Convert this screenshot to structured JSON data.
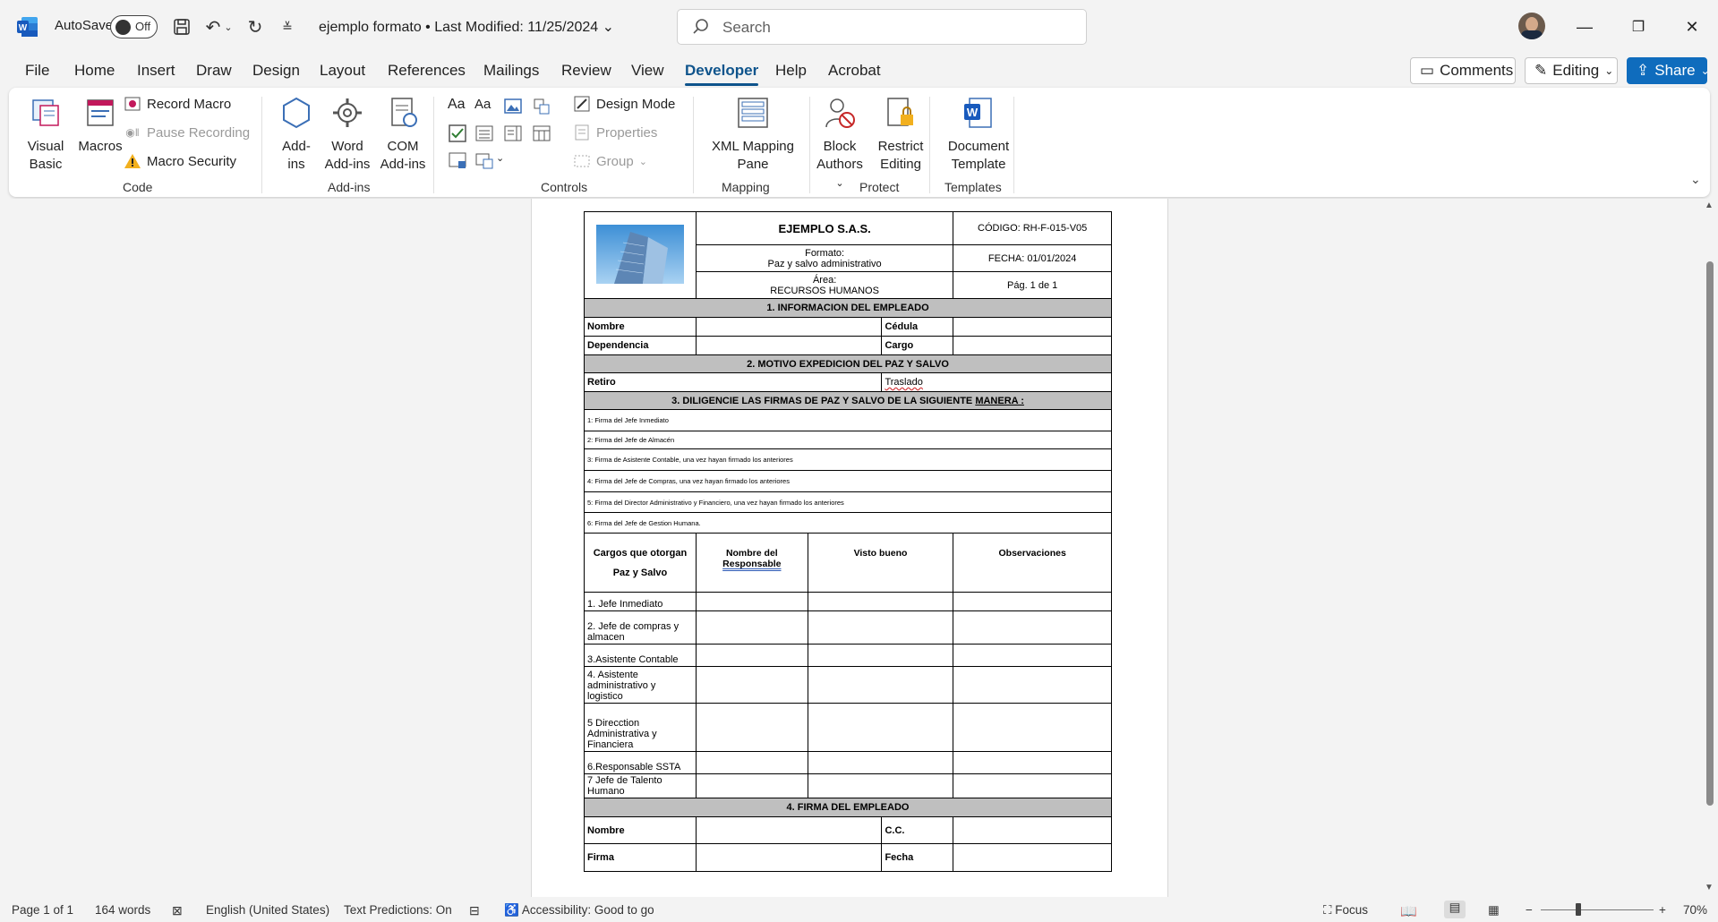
{
  "titlebar": {
    "autosave_label": "AutoSave",
    "autosave_state": "Off",
    "doc_title": "ejemplo formato • Last Modified: 11/25/2024",
    "search_placeholder": "Search"
  },
  "menu": {
    "tabs": [
      "File",
      "Home",
      "Insert",
      "Draw",
      "Design",
      "Layout",
      "References",
      "Mailings",
      "Review",
      "View",
      "Developer",
      "Help",
      "Acrobat"
    ],
    "active": "Developer",
    "comments": "Comments",
    "editing": "Editing",
    "share": "Share"
  },
  "ribbon": {
    "code": {
      "label": "Code",
      "visual_basic": "Visual Basic",
      "macros": "Macros",
      "record_macro": "Record Macro",
      "pause_recording": "Pause Recording",
      "macro_security": "Macro Security"
    },
    "addins": {
      "label": "Add-ins",
      "addins": "Add-ins",
      "word_addins": "Word Add-ins",
      "com_addins": "COM Add-ins"
    },
    "controls": {
      "label": "Controls",
      "design_mode": "Design Mode",
      "properties": "Properties",
      "group": "Group"
    },
    "mapping": {
      "label": "Mapping",
      "xml_pane": "XML Mapping Pane"
    },
    "protect": {
      "label": "Protect",
      "block_authors": "Block Authors",
      "restrict_editing": "Restrict Editing"
    },
    "templates": {
      "label": "Templates",
      "document_template": "Document Template"
    }
  },
  "document": {
    "company": "EJEMPLO S.A.S.",
    "codigo": "CÓDIGO: RH-F-015-V05",
    "formato_label": "Formato:",
    "formato_value": "Paz y salvo administrativo",
    "fecha": "FECHA: 01/01/2024",
    "area_label": "Área:",
    "area_value": "RECURSOS HUMANOS",
    "pag": "Pág. 1  de 1",
    "sec1": "1. INFORMACION DEL EMPLEADO",
    "nombre": "Nombre",
    "cedula": "Cédula",
    "dependencia": "Dependencia",
    "cargo": "Cargo",
    "sec2": "2. MOTIVO EXPEDICION DEL PAZ Y SALVO",
    "retiro": "Retiro",
    "traslado": "Traslado",
    "sec3_a": "3. DILIGENCIE LAS FIRMAS DE PAZ Y SALVO DE LA SIGUIENTE ",
    "sec3_b": "MANERA :",
    "steps": [
      "1: Firma del Jefe Inmediato",
      "2: Firma del Jefe de Almacén",
      "3: Firma de Asistente Contable, una vez hayan firmado los anteriores",
      "4: Firma del Jefe de Compras, una vez hayan firmado los anteriores",
      "5: Firma del  Director  Administrativo y Financiero, una vez hayan firmado los anteriores",
      "6: Firma del Jefe de  Gestion Humana."
    ],
    "col_cargos_1": "Cargos que otorgan",
    "col_cargos_2": "Paz y Salvo",
    "col_nombre_1": "Nombre del",
    "col_nombre_2": "Responsable",
    "col_visto": "Visto bueno",
    "col_obs": "Observaciones",
    "cargos": [
      "1. Jefe Inmediato",
      "2. Jefe de compras y almacen",
      "3.Asistente Contable",
      "4. Asistente administrativo y logistico",
      "5 Direcction Administrativa y Financiera",
      "6.Responsable SSTA",
      "7 Jefe de Talento Humano"
    ],
    "sec4": "4. FIRMA DEL EMPLEADO",
    "f_nombre": "Nombre",
    "f_cc": "C.C.",
    "f_firma": "Firma",
    "f_fecha": "Fecha"
  },
  "status": {
    "page": "Page 1 of 1",
    "words": "164 words",
    "language": "English (United States)",
    "predictions": "Text Predictions: On",
    "accessibility": "Accessibility: Good to go",
    "focus": "Focus",
    "zoom": "70%"
  },
  "colors": {
    "accent": "#0f548c",
    "share": "#0f6cbd",
    "section_gray": "#bfbfbf"
  }
}
